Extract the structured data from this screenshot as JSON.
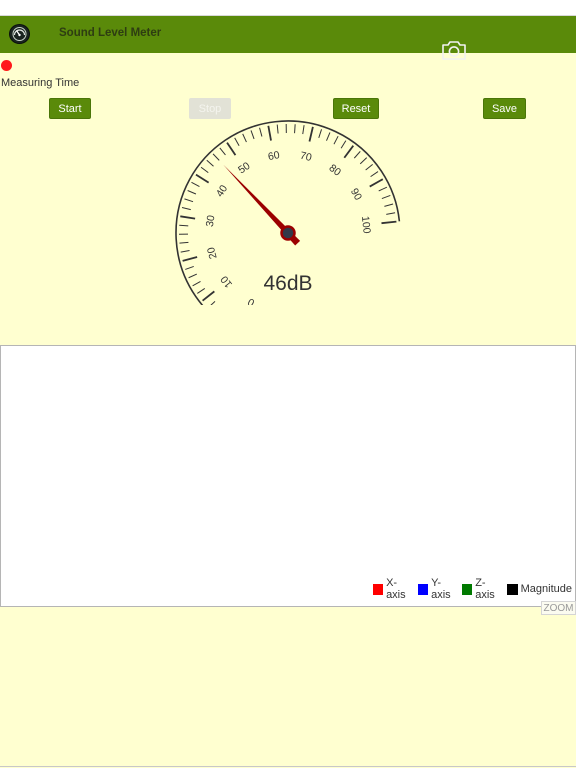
{
  "header": {
    "title": "Sound Level Meter",
    "logo_icon": "sound-meter-logo-icon",
    "camera_icon": "camera-icon",
    "background_color": "#5a8a0a"
  },
  "status": {
    "measuring_label": "Measuring Time",
    "recording_indicator_color": "#ff1a1a"
  },
  "controls": {
    "start_label": "Start",
    "stop_label": "Stop",
    "reset_label": "Reset",
    "save_label": "Save",
    "stop_enabled": false
  },
  "gauge": {
    "readout": "46dB",
    "value": 46,
    "min": 0,
    "max": 100,
    "tick_labels": [
      "0",
      "10",
      "20",
      "30",
      "40",
      "50",
      "60",
      "70",
      "80",
      "90",
      "100"
    ]
  },
  "chart": {
    "legend": [
      {
        "label": "X-axis",
        "color": "#ff0000"
      },
      {
        "label": "Y-axis",
        "color": "#0000ff"
      },
      {
        "label": "Z-axis",
        "color": "#007a00"
      },
      {
        "label": "Magnitude",
        "color": "#000000"
      }
    ],
    "zoom_label": "ZOOM"
  }
}
